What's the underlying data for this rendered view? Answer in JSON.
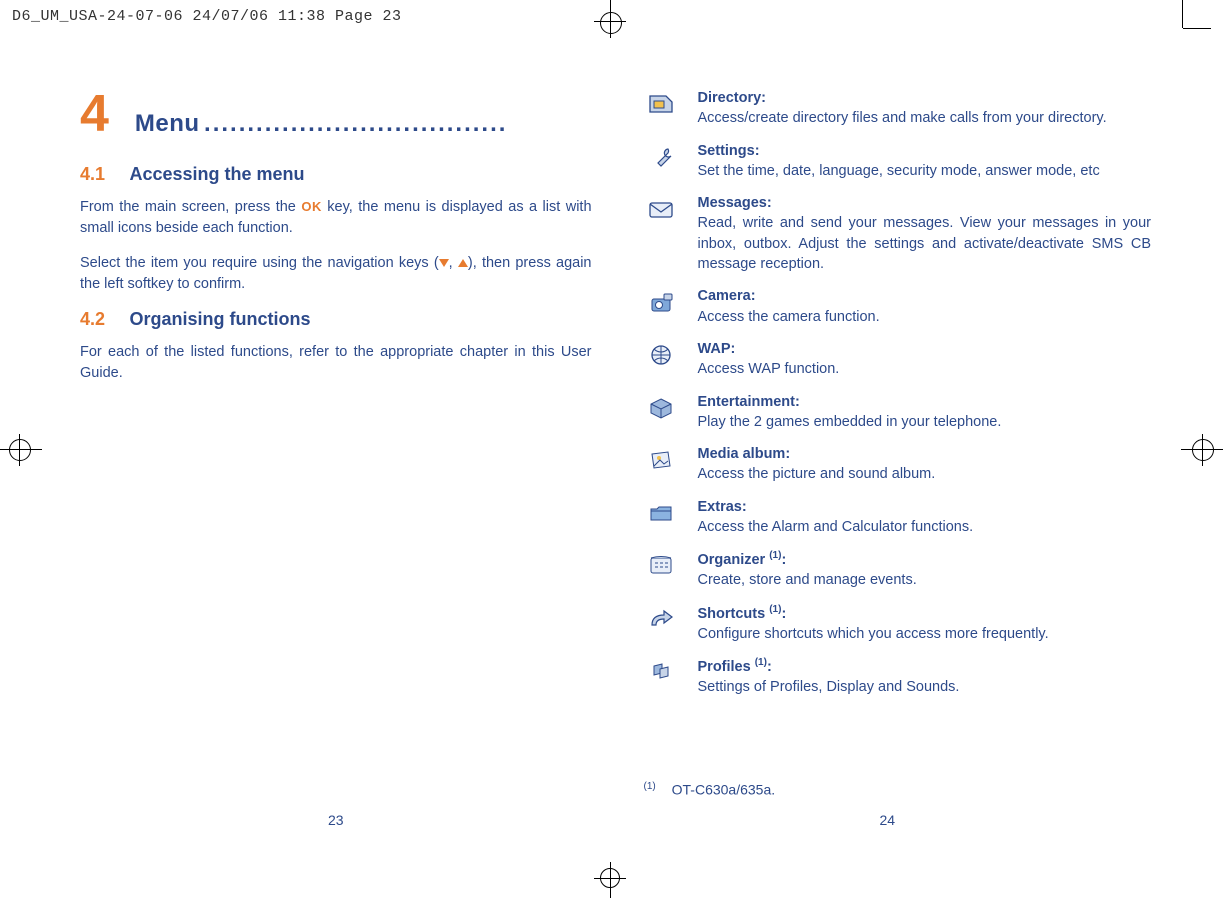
{
  "print_header": "D6_UM_USA-24-07-06  24/07/06  11:38  Page 23",
  "chapter": {
    "number": "4",
    "title": "Menu",
    "dots": "..................................."
  },
  "sections": {
    "s1": {
      "num": "4.1",
      "title": "Accessing the menu"
    },
    "s2": {
      "num": "4.2",
      "title": "Organising functions"
    }
  },
  "body": {
    "p1a": "From the main screen, press the ",
    "p1b": " key, the menu is displayed as a list with small icons beside each function.",
    "ok": "OK",
    "p2a": "Select the item you require using the navigation keys (",
    "p2b": ", ",
    "p2c": "), then press again the left softkey to confirm.",
    "p3": "For each of the listed functions, refer to the appropriate chapter in this User Guide."
  },
  "menu_items": [
    {
      "title": "Directory",
      "colon": ":",
      "desc": "Access/create directory files and make calls from your directory."
    },
    {
      "title": "Settings:",
      "colon": "",
      "desc": "Set the time, date, language, security mode, answer mode, etc"
    },
    {
      "title": "Messages:",
      "colon": "",
      "desc": "Read, write and send your messages. View your messages in your inbox, outbox. Adjust the settings and activate/deactivate SMS CB message reception."
    },
    {
      "title": "Camera:",
      "colon": "",
      "desc": "Access the camera function."
    },
    {
      "title": "WAP:",
      "colon": "",
      "desc": "Access WAP function."
    },
    {
      "title": "Entertainment:",
      "colon": "",
      "desc": "Play the 2 games embedded in your telephone."
    },
    {
      "title": "Media album:",
      "colon": "",
      "desc": "Access the picture and sound album."
    },
    {
      "title": "Extras:",
      "colon": "",
      "desc": "Access the Alarm and Calculator functions."
    },
    {
      "title": "Organizer ",
      "sup": "(1)",
      "colon": ":",
      "desc": "Create, store and manage events."
    },
    {
      "title": "Shortcuts ",
      "sup": "(1)",
      "colon": ":",
      "desc": "Configure shortcuts which you access more frequently."
    },
    {
      "title": "Profiles ",
      "sup": "(1)",
      "colon": ":",
      "desc": "Settings of Profiles, Display and Sounds."
    }
  ],
  "footnote": {
    "sup": "(1)",
    "text": "OT-C630a/635a."
  },
  "page_numbers": {
    "left": "23",
    "right": "24"
  }
}
